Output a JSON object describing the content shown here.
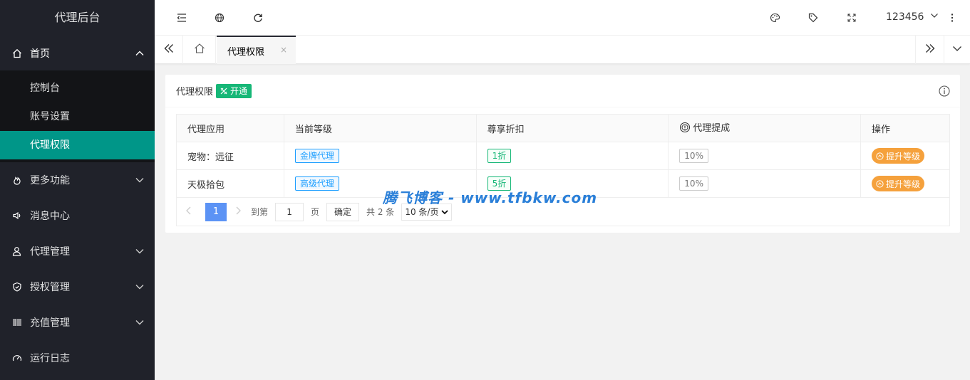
{
  "sidebar": {
    "logo": "代理后台",
    "home": {
      "label": "首页",
      "icon": "home-icon"
    },
    "sub_items": [
      "控制台",
      "账号设置",
      "代理权限"
    ],
    "items": [
      {
        "label": "更多功能",
        "icon": "fire-icon",
        "arrow": true
      },
      {
        "label": "消息中心",
        "icon": "speaker-icon",
        "arrow": false
      },
      {
        "label": "代理管理",
        "icon": "user-icon",
        "arrow": true
      },
      {
        "label": "授权管理",
        "icon": "shield-icon",
        "arrow": true
      },
      {
        "label": "充值管理",
        "icon": "barcode-icon",
        "arrow": true
      },
      {
        "label": "运行日志",
        "icon": "gauge-icon",
        "arrow": false
      }
    ]
  },
  "header": {
    "username": "123456"
  },
  "tabs": {
    "active_label": "代理权限",
    "close": "×"
  },
  "card": {
    "title": "代理权限",
    "open_button": "开通",
    "columns": [
      "代理应用",
      "当前等级",
      "尊享折扣",
      "代理提成",
      "操作"
    ],
    "rows": [
      {
        "app": "宠物：远征",
        "level": "金牌代理",
        "discount": "1折",
        "commission": "10%",
        "action": "提升等级"
      },
      {
        "app": "天极拾包",
        "level": "高级代理",
        "discount": "5折",
        "commission": "10%",
        "action": "提升等级"
      }
    ]
  },
  "pager": {
    "current": "1",
    "goto_label": "到第",
    "goto_value": "1",
    "page_unit": "页",
    "confirm": "确定",
    "total": "共 2 条",
    "page_size": "10 条/页"
  },
  "watermark": "腾飞博客 - www.tfbkw.com",
  "colors": {
    "sidebar": "#20222a",
    "active": "#009688",
    "open_btn": "#16b777",
    "upgrade": "#f5a13c",
    "page": "#5c93f5"
  }
}
